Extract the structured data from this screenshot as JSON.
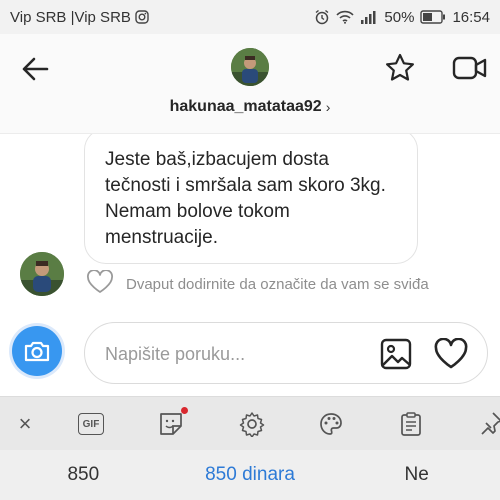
{
  "status_bar": {
    "carrier": "Vip SRB |Vip SRB",
    "battery": "50%",
    "time": "16:54"
  },
  "header": {
    "username": "hakunaa_matataa92",
    "chevron": "›",
    "icons": [
      "back-arrow-icon",
      "star-icon",
      "video-call-icon"
    ]
  },
  "conversation": {
    "message": "Jeste baš,izbacujem dosta tečnosti i smršala sam skoro 3kg. Nemam bolove tokom menstruacije.",
    "like_hint": "Dvaput dodirnite da označite da vam se sviđa"
  },
  "composer": {
    "placeholder": "Napišite poruku..."
  },
  "keyboard_toolbar": {
    "items": [
      "close-icon",
      "gif-icon",
      "sticker-icon",
      "settings-icon",
      "theme-palette-icon",
      "clipboard-icon",
      "pin-icon"
    ],
    "gif_label": "GIF",
    "close_label": "×",
    "sticker_has_notification": true
  },
  "suggestions": [
    "850",
    "850 dinara",
    "Ne"
  ],
  "colors": {
    "accent": "#3897f0",
    "notification_dot": "#d9282f",
    "suggestion_highlight": "#2d7ad6"
  }
}
